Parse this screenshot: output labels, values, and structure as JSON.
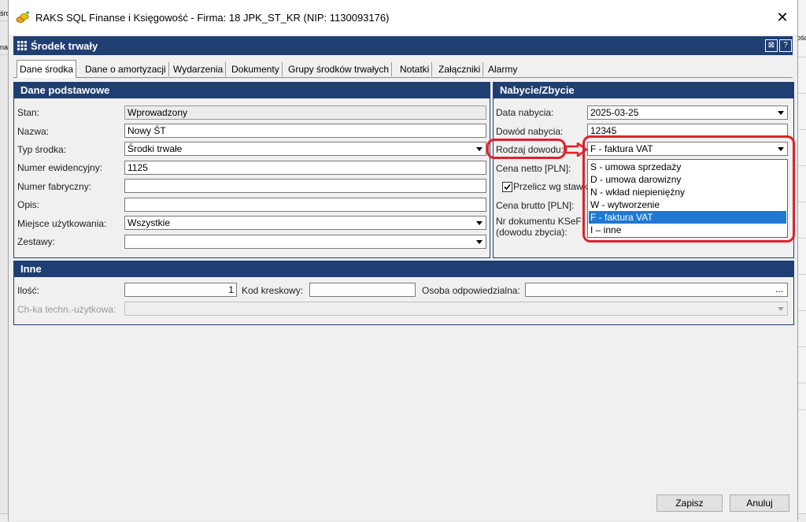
{
  "window": {
    "title": "RAKS SQL Finanse i Księgowość - Firma: 18 JPK_ST_KR (NIP: 1130093176)"
  },
  "background": {
    "left_texts": [
      "śro",
      "nal"
    ],
    "right_text": "ośc"
  },
  "form": {
    "title": "Środek trwały"
  },
  "tabs": [
    "Dane środka",
    "Dane o amortyzacji",
    "Wydarzenia",
    "Dokumenty",
    "Grupy środków trwałych",
    "Notatki",
    "Załączniki",
    "Alarmy"
  ],
  "basic": {
    "header": "Dane podstawowe",
    "stan_label": "Stan:",
    "stan_value": "Wprowadzony",
    "nazwa_label": "Nazwa:",
    "nazwa_value": "Nowy ŚT",
    "typ_label": "Typ środka:",
    "typ_value": "Środki trwałe",
    "numer_ew_label": "Numer ewidencyjny:",
    "numer_ew_value": "1125",
    "numer_fabr_label": "Numer fabryczny:",
    "opis_label": "Opis:",
    "miejsce_label": "Miejsce użytkowania:",
    "miejsce_value": "Wszystkie",
    "zestawy_label": "Zestawy:"
  },
  "acq": {
    "header": "Nabycie/Zbycie",
    "data_label": "Data nabycia:",
    "data_value": "2025-03-25",
    "dowod_label": "Dowód nabycia:",
    "dowod_value": "12345",
    "rodzaj_label": "Rodzaj dowodu:",
    "rodzaj_value": "F - faktura VAT",
    "cena_netto_label": "Cena netto [PLN]:",
    "przelicz_label": "Przelicz wg stawki",
    "cena_brutto_label": "Cena brutto [PLN]:",
    "ksef_label_1": "Nr dokumentu KSeF",
    "ksef_label_2": "(dowodu zbycia):",
    "options": [
      "S - umowa sprzedaży",
      "D - umowa darowizny",
      "N - wkład niepieniężny",
      "W - wytworzenie",
      "F - faktura VAT",
      "I – inne"
    ],
    "selected_option": 4
  },
  "other": {
    "header": "Inne",
    "ilosc_label": "Ilość:",
    "ilosc_value": "1",
    "kod_label": "Kod kreskowy:",
    "osoba_label": "Osoba odpowiedzialna:",
    "osoba_btn": "...",
    "chka_label": "Ch-ka techn.-użytkowa:"
  },
  "buttons": {
    "save": "Zapisz",
    "cancel": "Anuluj"
  },
  "colors": {
    "header_blue": "#1f3f73",
    "selection_blue": "#1f78d1",
    "highlight_red": "#e2202a"
  },
  "icons": {
    "app": "coins-icon",
    "close": "close-icon",
    "grid": "grid-icon"
  }
}
